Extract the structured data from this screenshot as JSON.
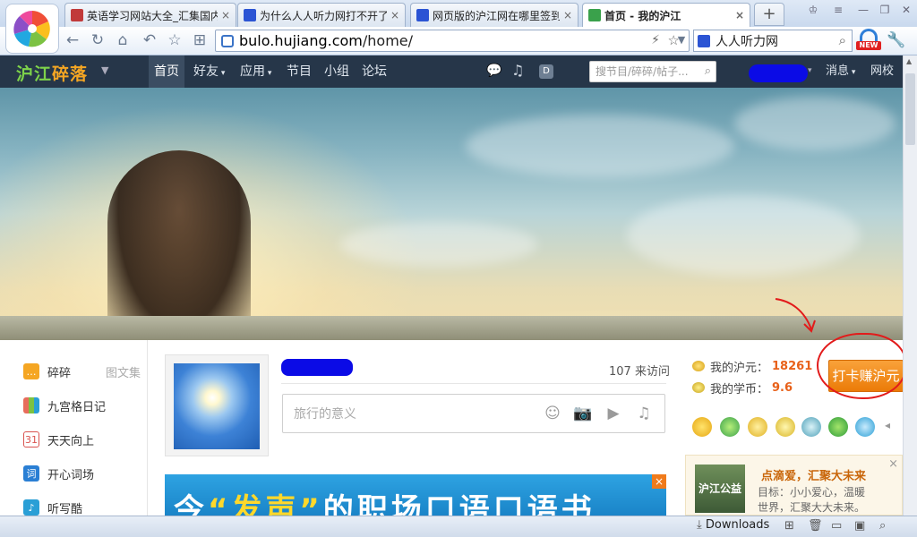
{
  "browser": {
    "tabs": [
      {
        "label": "英语学习网站大全_汇集国内",
        "active": false
      },
      {
        "label": "为什么人人听力网打不开了",
        "active": false
      },
      {
        "label": "网页版的沪江网在哪里签到",
        "active": false
      },
      {
        "label": "首页 - 我的沪江",
        "active": true
      }
    ],
    "new_tab": "+",
    "url_domain": "bulo.hujiang.com",
    "url_path": "/home/",
    "search_value": "人人听力网",
    "new_badge": "NEW",
    "status_downloads": "Downloads"
  },
  "site": {
    "logo_part1": "沪江",
    "logo_part2": "碎落",
    "nav": [
      {
        "label": "首页",
        "active": true
      },
      {
        "label": "好友",
        "has_menu": true
      },
      {
        "label": "应用",
        "has_menu": true
      },
      {
        "label": "节目"
      },
      {
        "label": "小组"
      },
      {
        "label": "论坛"
      }
    ],
    "search_placeholder": "搜节目/碎碎/帖子...",
    "user_menu": [
      {
        "label": "消息"
      },
      {
        "label": "网校"
      }
    ]
  },
  "sidebar": {
    "items": [
      {
        "label": "碎碎",
        "color": "#f5a623"
      },
      {
        "label": "九宫格日记",
        "color": "#e86d5c"
      },
      {
        "label": "天天向上",
        "color": "#d9534f"
      },
      {
        "label": "开心词场",
        "color": "#2a7fd4"
      },
      {
        "label": "听写酷",
        "color": "#2a9fd6"
      }
    ],
    "extra_link": "图文集"
  },
  "profile": {
    "visits": "107 来访问",
    "status_placeholder": "旅行的意义"
  },
  "ad": {
    "prefix": "今",
    "quote_open": "“",
    "highlight": "发声",
    "quote_close": "”",
    "rest": "的职场口语口语书",
    "close": "×"
  },
  "wallet": {
    "hujiang_coin_label": "我的沪元：",
    "hujiang_coin_value": "18261",
    "study_coin_label": "我的学币：",
    "study_coin_value": "9.6",
    "checkin_button": "打卡赚沪元"
  },
  "notice": {
    "image_text": "沪江公益",
    "title": "点滴爱，汇聚大未来",
    "description": "目标：小小爱心，温暖世界，汇聚大大未来。",
    "close": "×"
  },
  "colors": {
    "header_bg": "#263649",
    "accent_orange": "#eb7b08",
    "annotation_red": "#e21b1b"
  }
}
